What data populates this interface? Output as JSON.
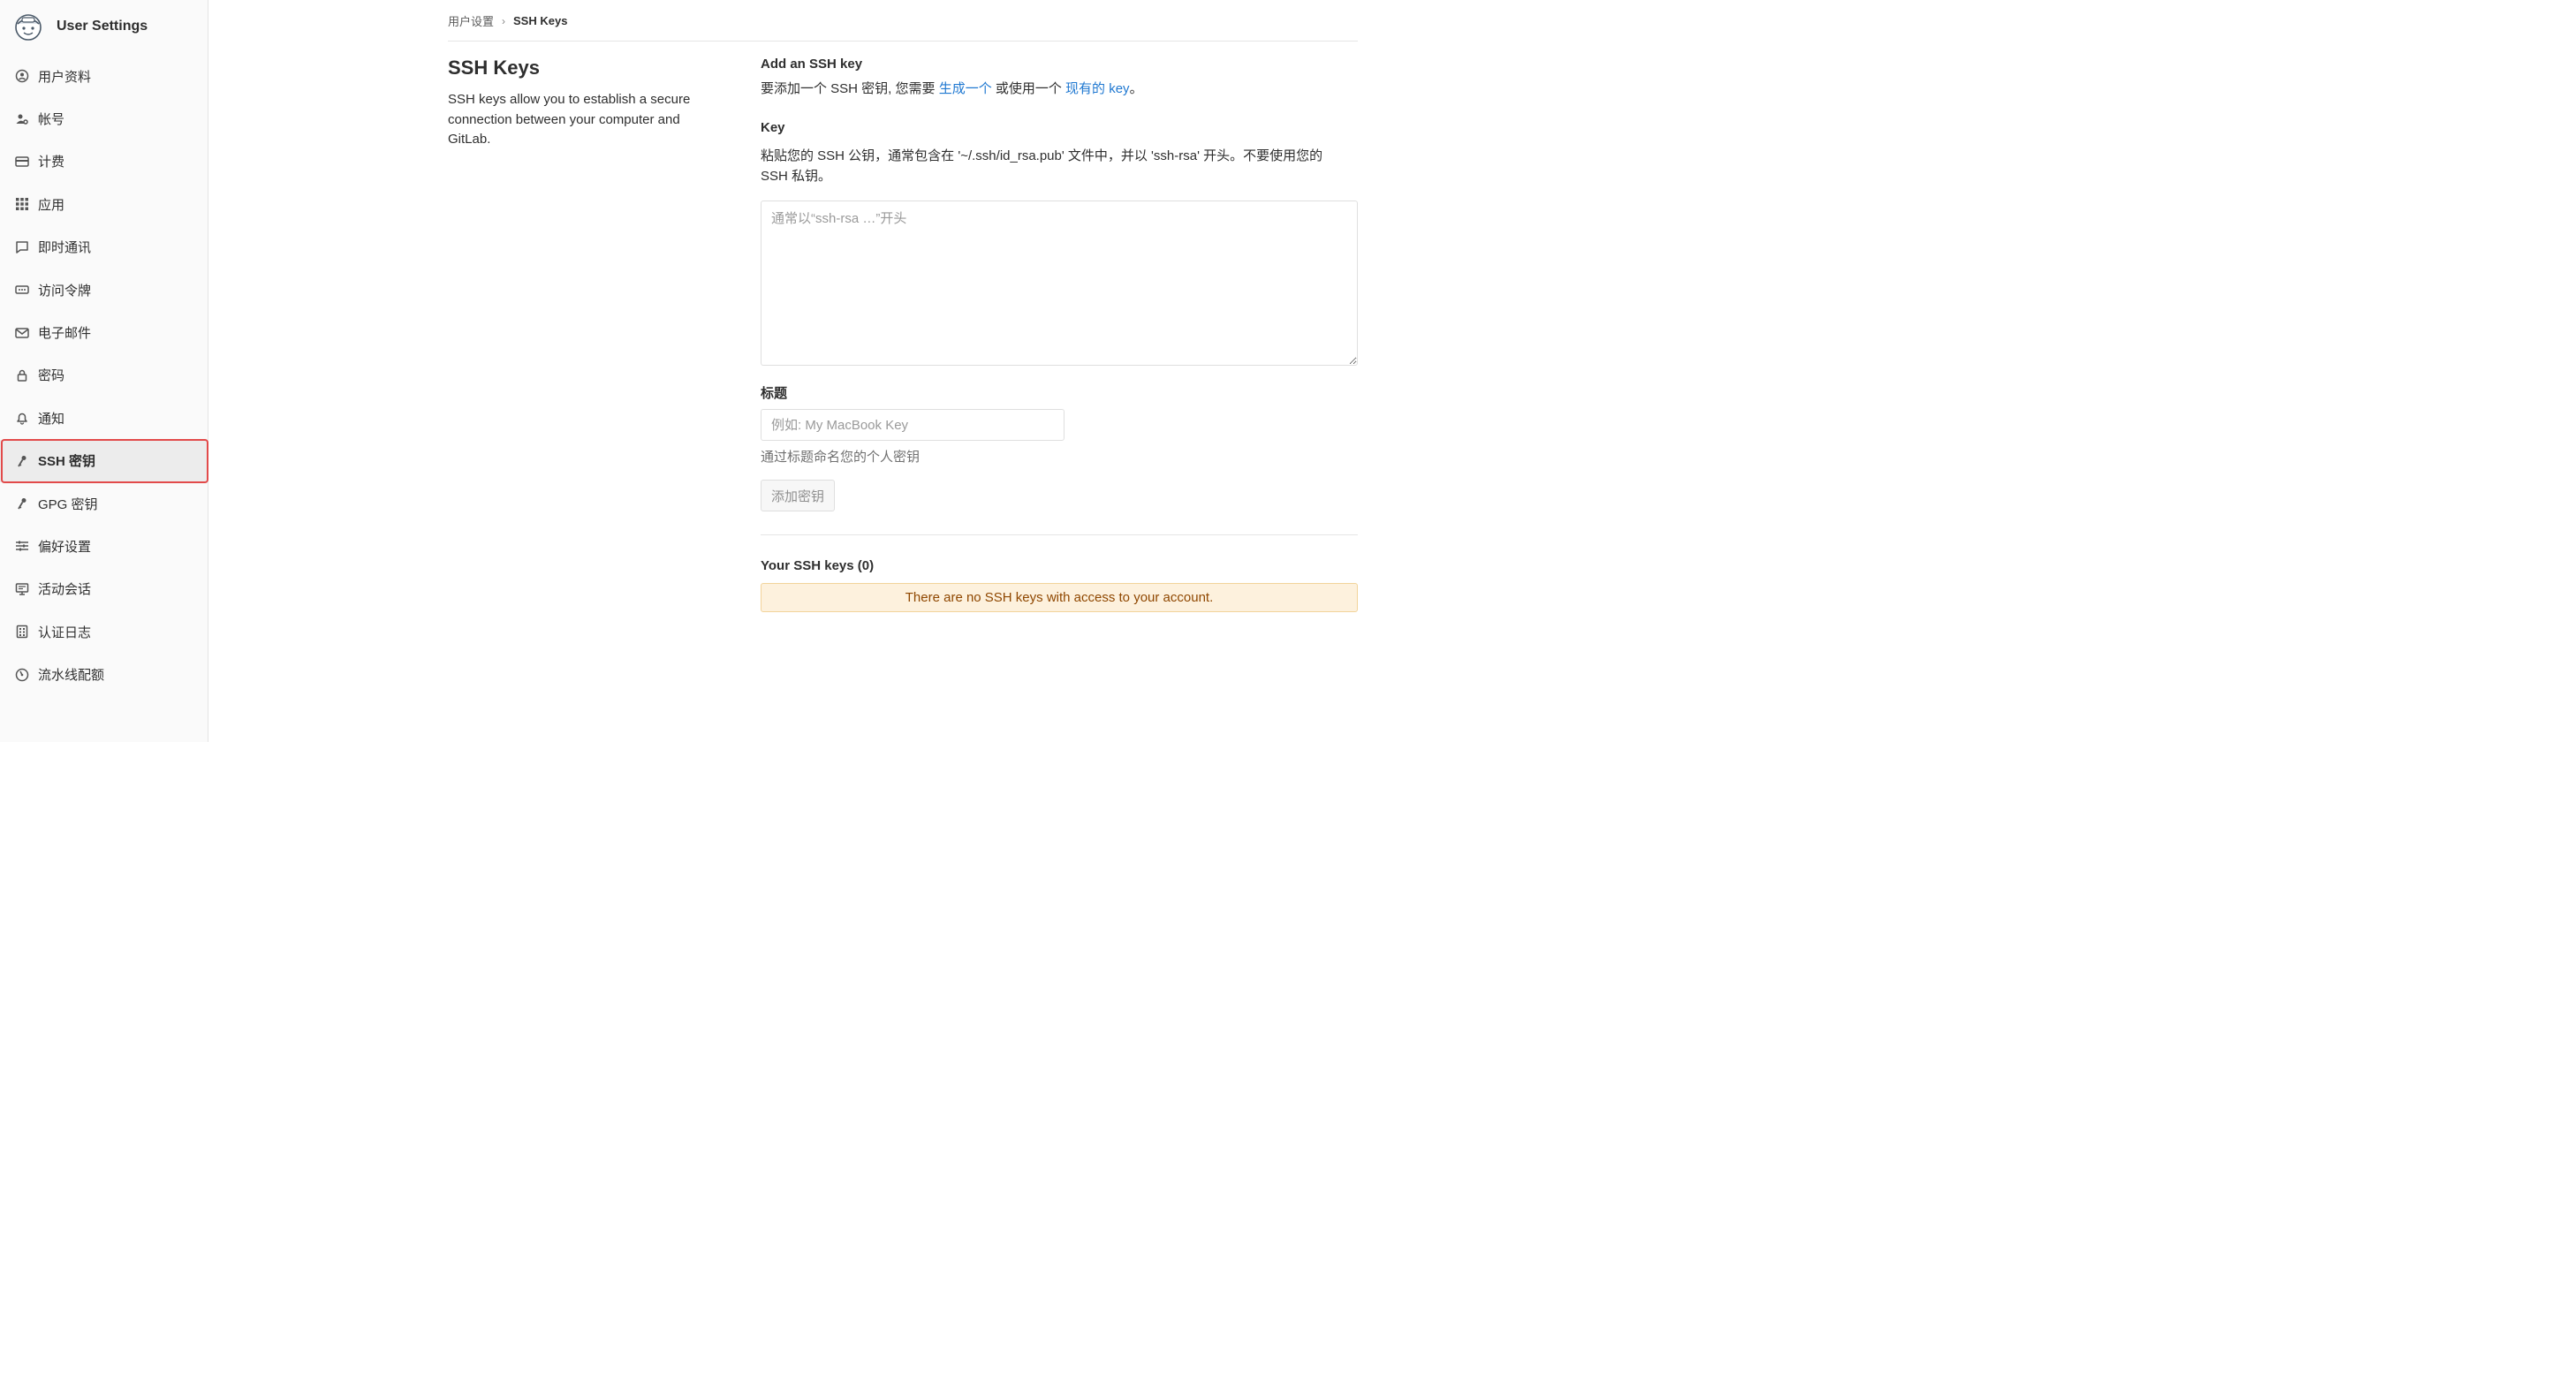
{
  "sidebar": {
    "title": "User Settings",
    "items": [
      {
        "label": "用户资料",
        "icon": "profile-icon"
      },
      {
        "label": "帐号",
        "icon": "account-icon"
      },
      {
        "label": "计费",
        "icon": "credit-card-icon"
      },
      {
        "label": "应用",
        "icon": "applications-icon"
      },
      {
        "label": "即时通讯",
        "icon": "chat-icon"
      },
      {
        "label": "访问令牌",
        "icon": "token-icon"
      },
      {
        "label": "电子邮件",
        "icon": "mail-icon"
      },
      {
        "label": "密码",
        "icon": "lock-icon"
      },
      {
        "label": "通知",
        "icon": "bell-icon"
      },
      {
        "label": "SSH 密钥",
        "icon": "key-icon",
        "active": true
      },
      {
        "label": "GPG 密钥",
        "icon": "key-icon"
      },
      {
        "label": "偏好设置",
        "icon": "preferences-icon"
      },
      {
        "label": "活动会话",
        "icon": "monitor-icon"
      },
      {
        "label": "认证日志",
        "icon": "log-icon"
      },
      {
        "label": "流水线配额",
        "icon": "quota-icon"
      }
    ]
  },
  "breadcrumb": {
    "parent": "用户设置",
    "current": "SSH Keys"
  },
  "page": {
    "title": "SSH Keys",
    "description": "SSH keys allow you to establish a secure connection between your computer and GitLab."
  },
  "form": {
    "section_title": "Add an SSH key",
    "intro_prefix": "要添加一个 SSH 密钥, 您需要 ",
    "intro_link1": "生成一个",
    "intro_middle": " 或使用一个 ",
    "intro_link2": "现有的 key",
    "intro_suffix": "。",
    "key_label": "Key",
    "key_help": "粘贴您的 SSH 公钥，通常包含在 '~/.ssh/id_rsa.pub' 文件中，并以 'ssh-rsa' 开头。不要使用您的 SSH 私钥。",
    "key_placeholder": "通常以“ssh-rsa …”开头",
    "key_value": "",
    "title_label": "标题",
    "title_placeholder": "例如: My MacBook Key",
    "title_value": "",
    "title_help": "通过标题命名您的个人密钥",
    "add_button": "添加密钥"
  },
  "keys": {
    "heading": "Your SSH keys (0)",
    "empty_message": "There are no SSH keys with access to your account."
  },
  "colors": {
    "link": "#1f78d1",
    "highlight": "#e24a4a",
    "alert_bg": "#fdf1dd",
    "alert_text": "#8f4700"
  }
}
